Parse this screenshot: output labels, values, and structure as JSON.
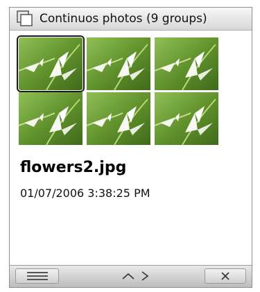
{
  "window": {
    "title": "Continuos photos (9 groups)",
    "icon": "photo-stack-icon"
  },
  "thumbnails": [
    {
      "name": "thumb-1",
      "selected": true
    },
    {
      "name": "thumb-2",
      "selected": false
    },
    {
      "name": "thumb-3",
      "selected": false
    },
    {
      "name": "thumb-4",
      "selected": false
    },
    {
      "name": "thumb-5",
      "selected": false
    },
    {
      "name": "thumb-6",
      "selected": false
    }
  ],
  "details": {
    "filename": "flowers2.jpg",
    "timestamp": "01/07/2006 3:38:25 PM"
  },
  "softkeys": {
    "left_icon": "menu-icon",
    "center_icons": [
      "up-chevron-icon",
      "right-chevron-icon"
    ],
    "right_icon": "close-icon"
  },
  "colors": {
    "accent": "#1a1a1a",
    "photo_green": "#6a9a32"
  }
}
